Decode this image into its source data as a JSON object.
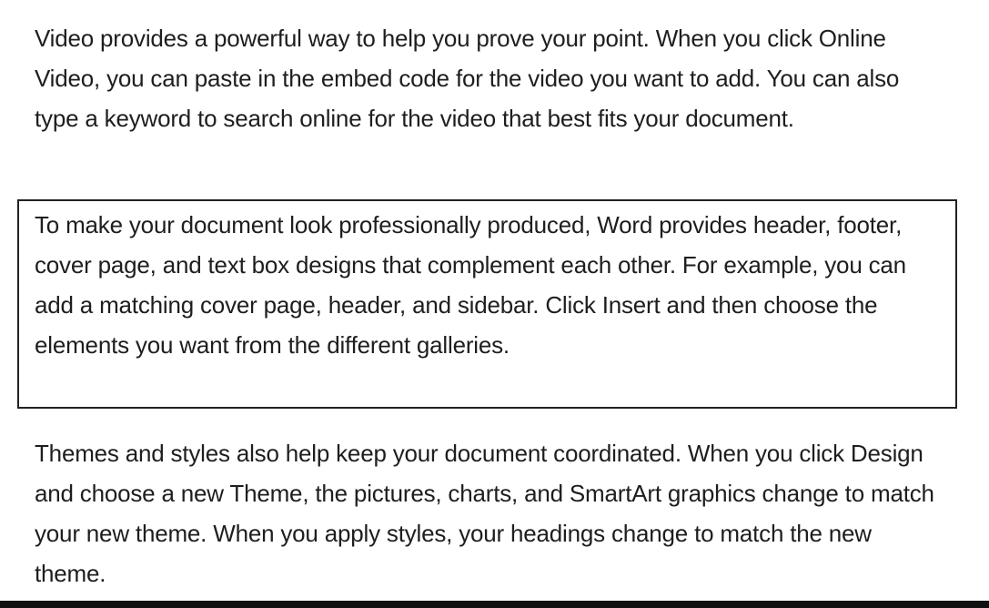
{
  "document": {
    "paragraph_1": "Video provides a powerful way to help you prove your point. When you click Online Video, you can paste in the embed code for the video you want to add. You can also type a keyword to search online for the video that best fits your document.",
    "bordered_paragraph": "To make your document look professionally produced, Word provides header, footer, cover page, and text box designs that complement each other. For example, you can add a matching cover page, header, and sidebar. Click Insert and then choose the elements you want from the different galleries.",
    "paragraph_3": "Themes and styles also help keep your document coordinated. When you click Design and choose a new Theme, the pictures, charts, and SmartArt graphics change to match your new theme. When you apply styles, your headings change to match the new theme."
  },
  "colors": {
    "text": "#1e1e1e",
    "border": "#222222",
    "background": "#ffffff"
  }
}
